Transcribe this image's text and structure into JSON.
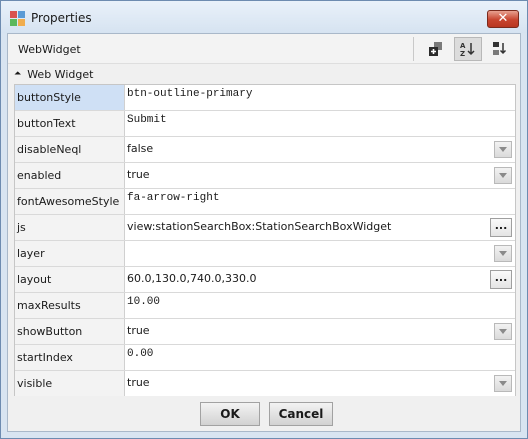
{
  "window": {
    "title": "Properties",
    "close_glyph": "✕"
  },
  "header": {
    "object_name": "WebWidget",
    "tools": [
      {
        "icon": "add-slot-icon"
      },
      {
        "icon": "sort-az-icon",
        "active": true
      },
      {
        "icon": "sort-order-icon"
      }
    ]
  },
  "section": {
    "collapse_glyph": "⏶",
    "title": "Web Widget"
  },
  "properties": [
    {
      "name": "buttonStyle",
      "value": "btn-outline-primary",
      "mono": true,
      "editor": "none",
      "selected": true
    },
    {
      "name": "buttonText",
      "value": "Submit",
      "mono": true,
      "editor": "none"
    },
    {
      "name": "disableNeql",
      "value": "false",
      "mono": false,
      "editor": "dropdown"
    },
    {
      "name": "enabled",
      "value": "true",
      "mono": false,
      "editor": "dropdown"
    },
    {
      "name": "fontAwesomeStyle",
      "value": "fa-arrow-right",
      "mono": true,
      "editor": "none"
    },
    {
      "name": "js",
      "value": "view:stationSearchBox:StationSearchBoxWidget",
      "mono": false,
      "editor": "ellipsis"
    },
    {
      "name": "layer",
      "value": "",
      "mono": false,
      "editor": "dropdown"
    },
    {
      "name": "layout",
      "value": "60.0,130.0,740.0,330.0",
      "mono": false,
      "editor": "ellipsis"
    },
    {
      "name": "maxResults",
      "value": "10.00",
      "mono": true,
      "editor": "none"
    },
    {
      "name": "showButton",
      "value": "true",
      "mono": false,
      "editor": "dropdown"
    },
    {
      "name": "startIndex",
      "value": "0.00",
      "mono": true,
      "editor": "none"
    },
    {
      "name": "visible",
      "value": "true",
      "mono": false,
      "editor": "dropdown"
    }
  ],
  "ellipsis_label": "...",
  "footer": {
    "ok_label": "OK",
    "cancel_label": "Cancel"
  },
  "colors": {
    "titlebar": "#d6e3f1",
    "selected_row": "#cfe0f5",
    "close_button": "#c8442e"
  }
}
